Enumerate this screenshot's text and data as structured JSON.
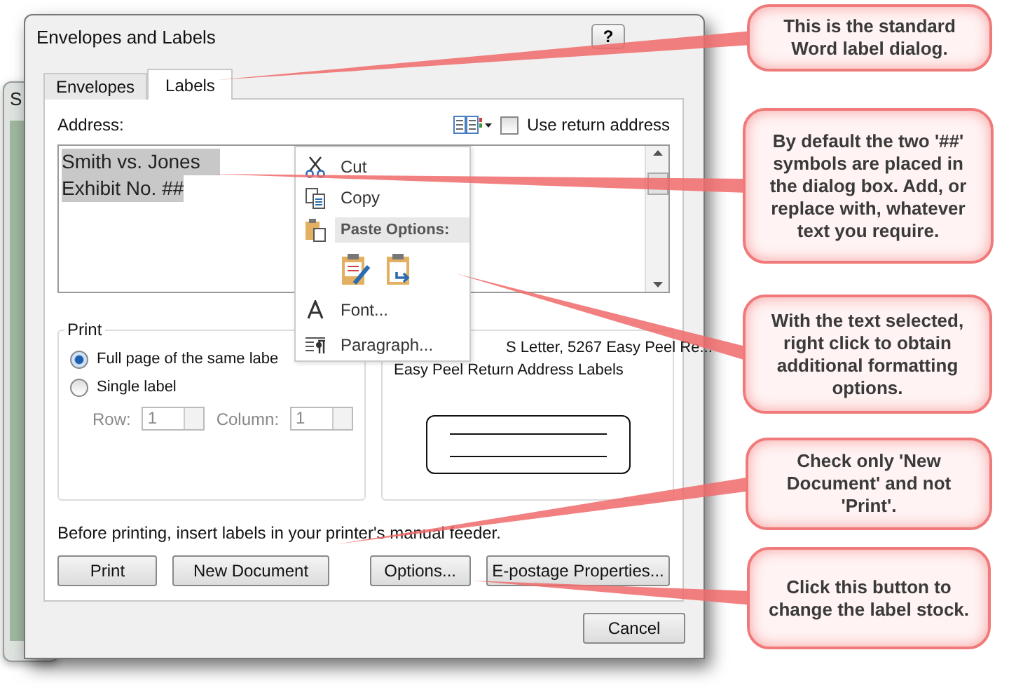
{
  "background_window": {
    "title": "S"
  },
  "window": {
    "title": "Envelopes and Labels",
    "help": "?"
  },
  "tabs": [
    {
      "label": "Envelopes",
      "selected": false
    },
    {
      "label": "Labels",
      "selected": true
    }
  ],
  "address": {
    "label": "Address:",
    "lines": [
      "Smith vs. Jones",
      "Exhibit No. ##"
    ],
    "use_return_address": {
      "label": "Use return address",
      "checked": false
    }
  },
  "context_menu": [
    {
      "kind": "cut",
      "label": "Cut"
    },
    {
      "kind": "copy",
      "label": "Copy"
    },
    {
      "kind": "paste_header",
      "label": "Paste Options:"
    },
    {
      "kind": "paste_buttons"
    },
    {
      "kind": "font",
      "label": "Font..."
    },
    {
      "kind": "paragraph",
      "label": "Paragraph..."
    }
  ],
  "print": {
    "title": "Print",
    "options": [
      {
        "label": "Full page of the same labe",
        "selected": true
      },
      {
        "label": "Single label",
        "selected": false
      }
    ],
    "row": {
      "label": "Row:",
      "value": "1",
      "disabled": true
    },
    "column": {
      "label": "Column:",
      "value": "1",
      "disabled": true
    }
  },
  "label": {
    "lines": [
      "S Letter, 5267 Easy Peel Re...",
      "Easy Peel Return Address Labels"
    ]
  },
  "note": "Before printing, insert labels in your printer's manual feeder.",
  "buttons": [
    "Print",
    "New Document",
    "Options...",
    "E-postage Properties..."
  ],
  "cancel": "Cancel",
  "callouts": [
    "This is the standard Word label dialog.",
    "By default the two '##' symbols are placed in the dialog box. Add, or replace with, whatever text you require.",
    "With the text selected, right click to obtain additional formatting options.",
    "Check only 'New Document' and not 'Print'.",
    "Click this button to change the label stock."
  ]
}
